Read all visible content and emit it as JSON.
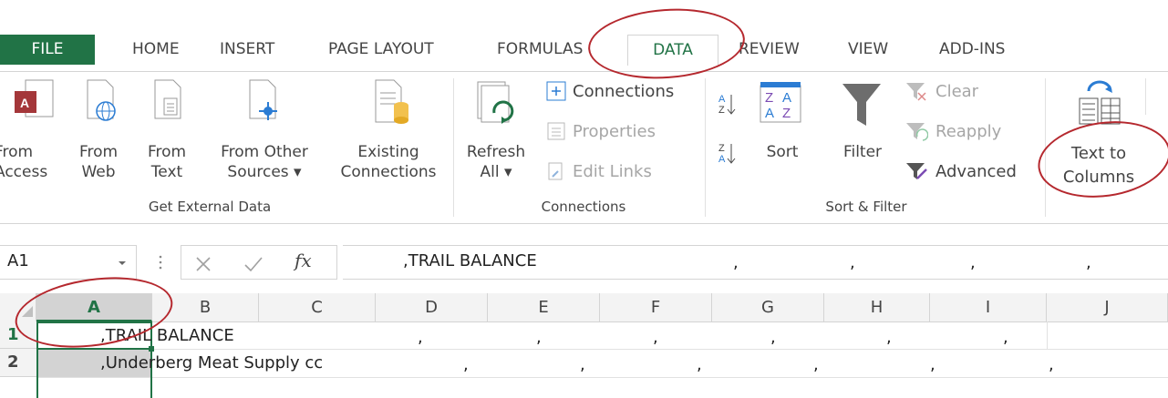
{
  "tabs": [
    "FILE",
    "HOME",
    "INSERT",
    "PAGE LAYOUT",
    "FORMULAS",
    "DATA",
    "REVIEW",
    "VIEW",
    "ADD-INS"
  ],
  "ribbon": {
    "get_external": {
      "from_access": [
        "From",
        "Access"
      ],
      "from_web": [
        "From",
        "Web"
      ],
      "from_text": [
        "From",
        "Text"
      ],
      "from_other": [
        "From Other",
        "Sources ▾"
      ],
      "existing": [
        "Existing",
        "Connections"
      ],
      "group_label": "Get External Data"
    },
    "connections": {
      "refresh": [
        "Refresh",
        "All ▾"
      ],
      "connections": "Connections",
      "properties": "Properties",
      "edit_links": "Edit Links",
      "group_label": "Connections"
    },
    "sort_filter": {
      "sort": "Sort",
      "filter": "Filter",
      "clear": "Clear",
      "reapply": "Reapply",
      "advanced": "Advanced",
      "group_label": "Sort & Filter"
    },
    "data_tools": {
      "text_to_columns": [
        "Text to",
        "Columns"
      ]
    }
  },
  "formula_bar": {
    "name_box": "A1",
    "fx": "fx",
    "value": ",TRAIL BALANCE",
    "comma": ","
  },
  "columns": [
    "A",
    "B",
    "C",
    "D",
    "E",
    "F",
    "G",
    "H",
    "I",
    "J"
  ],
  "rows": [
    {
      "num": "1",
      "text": ",TRAIL BALANCE"
    },
    {
      "num": "2",
      "text": ",Underberg Meat Supply cc"
    }
  ],
  "comma": ",",
  "colors": {
    "excel_green": "#217346",
    "annotation": "#b5282e"
  }
}
